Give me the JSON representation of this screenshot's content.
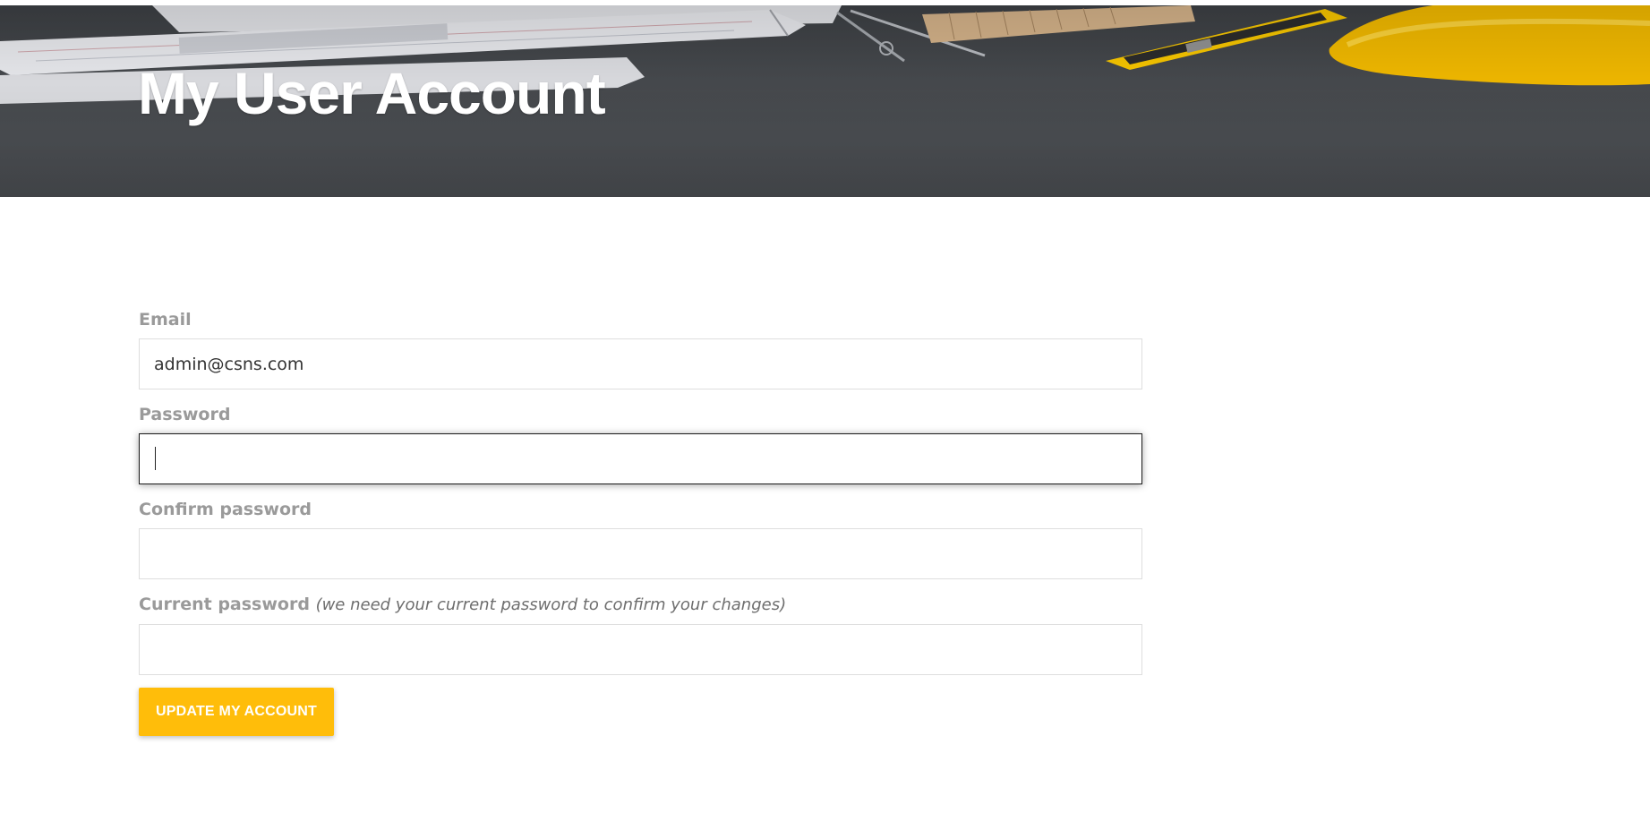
{
  "page": {
    "title": "My User Account"
  },
  "form": {
    "email_label": "Email",
    "email_value": "admin@csns.com",
    "password_label": "Password",
    "password_value": "",
    "confirm_label": "Confirm password",
    "confirm_value": "",
    "current_label": "Current password",
    "current_hint": "(we need your current password to confirm your changes)",
    "current_value": "",
    "submit_label": "UPDATE MY ACCOUNT"
  },
  "colors": {
    "accent": "#ffbd0a",
    "label": "#9a9a9a",
    "hero_background": "#45484c"
  }
}
